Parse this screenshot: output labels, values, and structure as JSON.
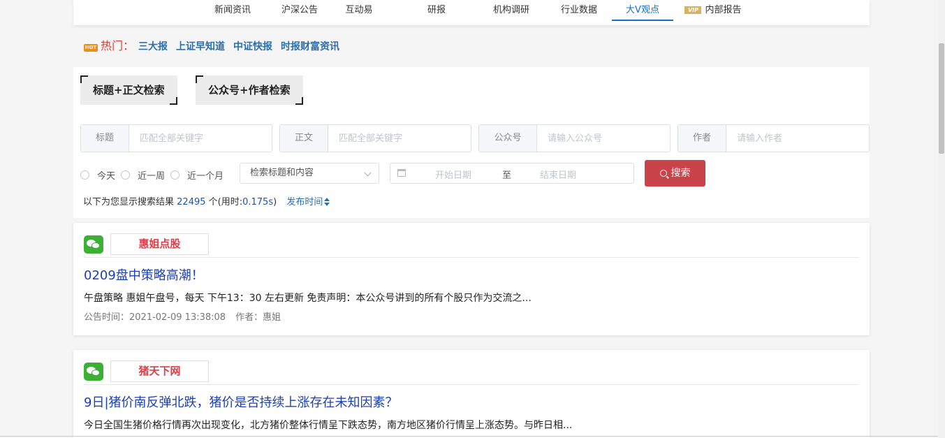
{
  "nav": {
    "items": [
      {
        "label": "新闻资讯"
      },
      {
        "label": "沪深公告"
      },
      {
        "label": "互动易"
      },
      {
        "label": "研报"
      },
      {
        "label": "机构调研"
      },
      {
        "label": "行业数据"
      },
      {
        "label": "大V观点",
        "active": true
      },
      {
        "label": "内部报告",
        "badge": "VIP"
      }
    ]
  },
  "hot": {
    "icon_text": "HOT",
    "label": "热门：",
    "links": [
      "三大报",
      "上证早知道",
      "中证快报",
      "时报财富资讯"
    ]
  },
  "search": {
    "tabs": [
      "标题+正文检索",
      "公众号+作者检索"
    ],
    "fields": [
      {
        "label": "标题",
        "placeholder": "匹配全部关键字"
      },
      {
        "label": "正文",
        "placeholder": "匹配全部关键字"
      },
      {
        "label": "公众号",
        "placeholder": "请输入公众号"
      },
      {
        "label": "作者",
        "placeholder": "请输入作者"
      }
    ],
    "radios": [
      "今天",
      "近一周",
      "近一个月"
    ],
    "select_value": "检索标题和内容",
    "date_start": "开始日期",
    "date_sep": "至",
    "date_end": "结束日期",
    "button_label": "搜索"
  },
  "results_info": {
    "prefix": "以下为您显示搜索结果",
    "count": "22495",
    "suffix": "个(用时:",
    "time": "0.175s",
    "close": ")",
    "sort_label": "发布时间"
  },
  "results": [
    {
      "source": "惠姐点股",
      "title": "0209盘中策略高潮！",
      "summary": "午盘策略 惠姐午盘号，每天 下午13：30 左右更新 免责声明：本公众号讲到的所有个股只作为交流之...",
      "time_label": "公告时间：2021-02-09 13:38:08",
      "author_label": "作者：惠姐"
    },
    {
      "source": "猪天下网",
      "title": "9日|猪价南反弹北跌，猪价是否持续上涨存在未知因素？",
      "summary": "今日全国生猪价格行情再次出现变化，北方猪价整体行情呈下跌态势，南方地区猪价行情呈上涨态势。与昨日相...",
      "time_label": "",
      "author_label": ""
    }
  ]
}
